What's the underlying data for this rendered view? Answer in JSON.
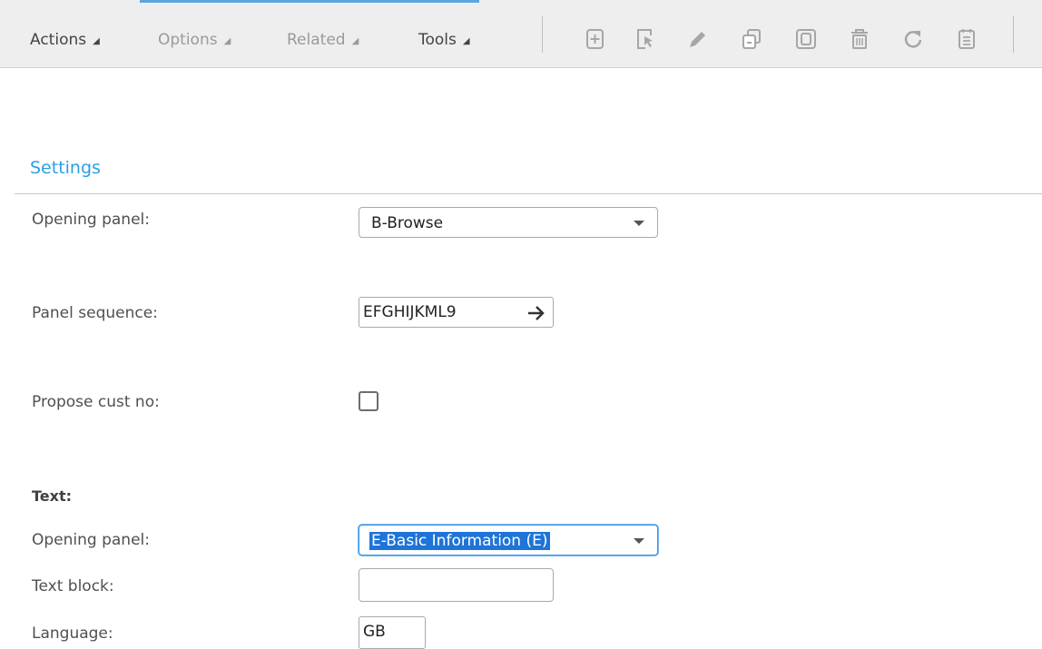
{
  "toolbar": {
    "menus": [
      {
        "label": "Actions",
        "active": true
      },
      {
        "label": "Options",
        "active": false
      },
      {
        "label": "Related",
        "active": false
      },
      {
        "label": "Tools",
        "active": true
      }
    ],
    "menu_arrow": "◢",
    "icons": [
      "add-icon",
      "select-icon",
      "edit-icon",
      "copy-icon",
      "display-icon",
      "delete-icon",
      "refresh-icon",
      "notes-icon"
    ]
  },
  "settings": {
    "title": "Settings",
    "opening_panel": {
      "label": "Opening panel:",
      "value": "B-Browse"
    },
    "panel_sequence": {
      "label": "Panel sequence:",
      "value": "EFGHIJKML9"
    },
    "propose_cust_no": {
      "label": "Propose cust no:",
      "checked": false
    }
  },
  "text_section": {
    "heading": "Text:",
    "opening_panel": {
      "label": "Opening panel:",
      "value": "E-Basic Information (E)"
    },
    "text_block": {
      "label": "Text block:",
      "value": ""
    },
    "language": {
      "label": "Language:",
      "value": "GB"
    }
  },
  "colors": {
    "accent": "#2aa0e6",
    "selection": "#1e74d8"
  }
}
